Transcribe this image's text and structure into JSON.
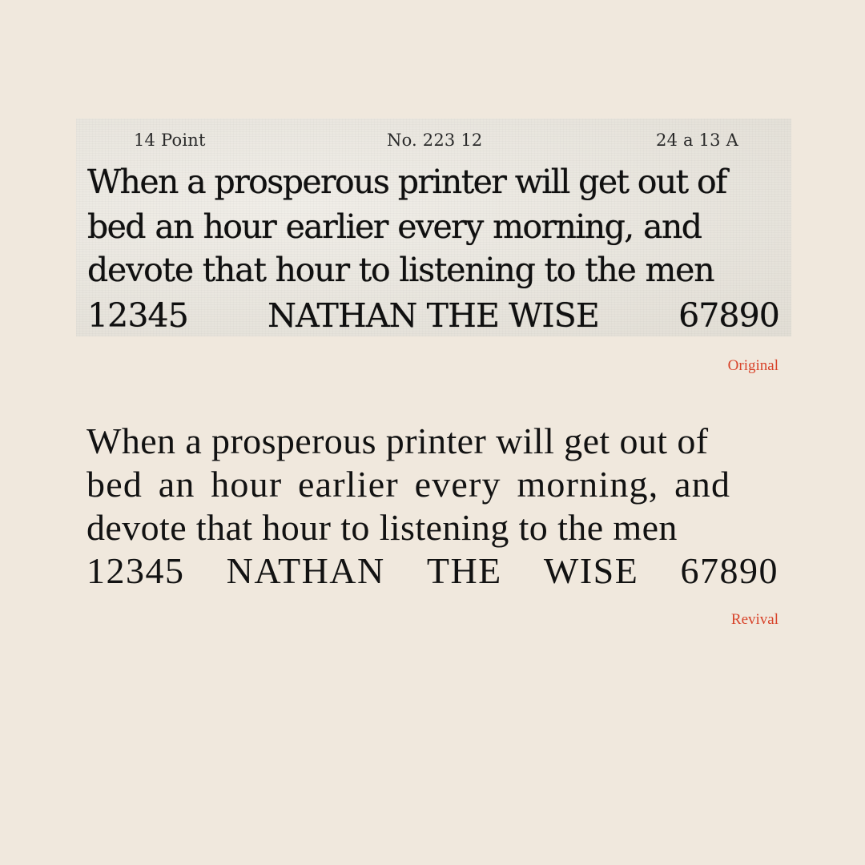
{
  "original": {
    "header": {
      "point_size": "14 Point",
      "catalog_number": "No. 223 12",
      "font_count": "24 a 13 A"
    },
    "lines": [
      "When a prosperous printer will get out of",
      "bed an hour earlier every morning, and",
      "devote that hour to listening to the men"
    ],
    "showing_line": {
      "left_numerals": "12345",
      "title": "NATHAN THE WISE",
      "right_numerals": "67890"
    },
    "caption": "Original"
  },
  "revival": {
    "lines": [
      "When a prosperous printer will get out of",
      "bed an hour earlier every morning, and",
      "devote that hour to listening to the men"
    ],
    "showing_line": {
      "left_numerals": "12345",
      "title_word_1": "NATHAN",
      "title_word_2": "THE",
      "title_word_3": "WISE",
      "right_numerals": "67890"
    },
    "caption": "Revival"
  },
  "colors": {
    "background": "#f0e8dd",
    "caption": "#d8432a",
    "ink": "#141414"
  }
}
